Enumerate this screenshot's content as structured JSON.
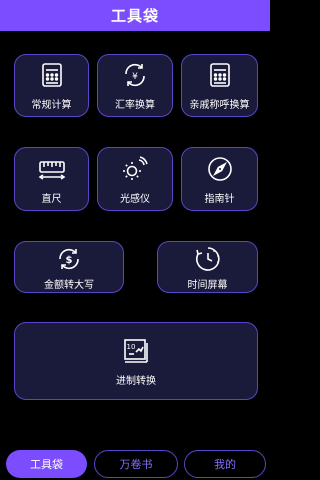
{
  "header": {
    "title": "工具袋"
  },
  "tools": {
    "calculator": {
      "label": "常规计算",
      "icon": "calculator-icon"
    },
    "exchange": {
      "label": "汇率换算",
      "icon": "currency-exchange-icon"
    },
    "kinship": {
      "label": "亲戚称呼换算",
      "icon": "calculator-icon"
    },
    "ruler": {
      "label": "直尺",
      "icon": "ruler-icon"
    },
    "light_sensor": {
      "label": "光感仪",
      "icon": "light-sensor-icon"
    },
    "compass": {
      "label": "指南针",
      "icon": "compass-icon"
    },
    "money_uppercase": {
      "label": "金额转大写",
      "icon": "dollar-cycle-icon"
    },
    "screen_timer": {
      "label": "时间屏幕",
      "icon": "timer-icon"
    },
    "base_convert": {
      "label": "进制转换",
      "icon": "base-convert-icon"
    }
  },
  "tabbar": {
    "toolbag": "工具袋",
    "books": "万卷书",
    "mine": "我的"
  },
  "colors": {
    "accent": "#7c4dff",
    "tile_bg": "#1a1a3a",
    "tile_border": "#5a45c8",
    "background": "#000000"
  }
}
